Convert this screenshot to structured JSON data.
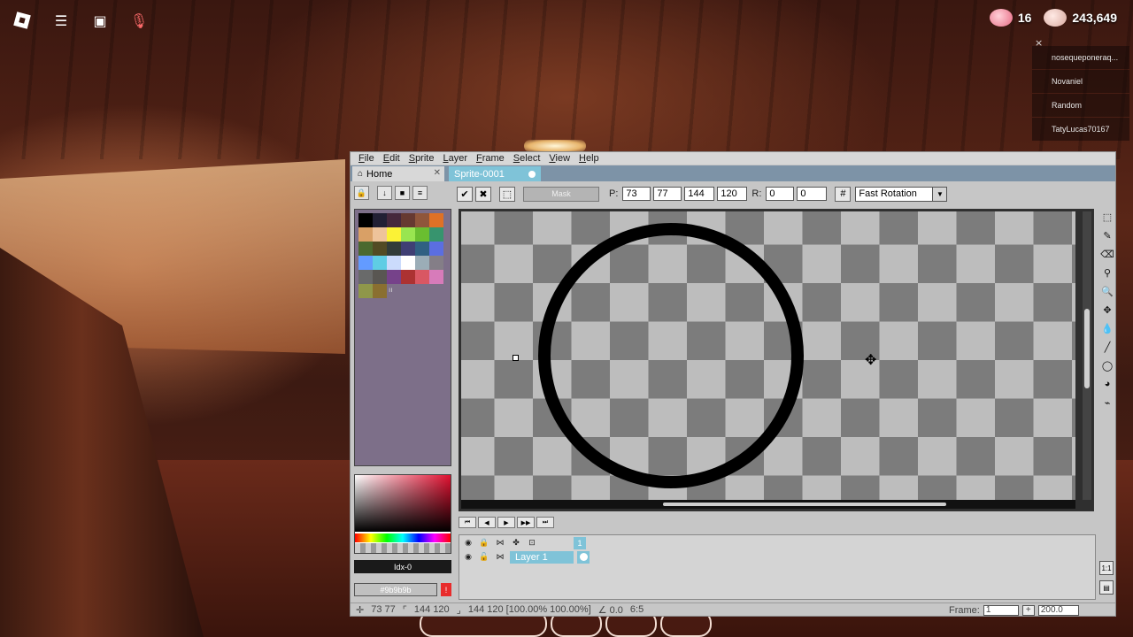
{
  "roblox": {
    "currency": {
      "hearts": "16",
      "coins": "243,649"
    },
    "players": [
      "nosequeponeraq...",
      "Novaniel",
      "Random",
      "TatyLucas70167"
    ],
    "close_icon": "×"
  },
  "aseprite": {
    "menu": [
      "File",
      "Edit",
      "Sprite",
      "Layer",
      "Frame",
      "Select",
      "View",
      "Help"
    ],
    "tabs": {
      "home": "Home",
      "sprite": "Sprite-0001"
    },
    "context": {
      "mask_label": "Mask",
      "p_label": "P:",
      "x": "73",
      "y": "77",
      "w": "144",
      "h": "120",
      "r_label": "R:",
      "r1": "0",
      "r2": "0",
      "rotation": "Fast Rotation"
    },
    "palette": [
      "#000000",
      "#222034",
      "#45283c",
      "#663931",
      "#8f563b",
      "#df7126",
      "#d9a066",
      "#eec39a",
      "#fbf236",
      "#99e550",
      "#6abe30",
      "#37946e",
      "#4b692f",
      "#524b24",
      "#323c39",
      "#3f3f74",
      "#306082",
      "#5b6ee1",
      "#639bff",
      "#5fcde4",
      "#cbdbfc",
      "#ffffff",
      "#9badb7",
      "#847e87",
      "#696a6a",
      "#595652",
      "#76428a",
      "#ac3232",
      "#d95763",
      "#d77bba",
      "#8f974a",
      "#8a6f30"
    ],
    "palette_label": "ıı",
    "idx": "Idx-0",
    "hex": "#9b9b9b",
    "layer": {
      "name": "Layer 1",
      "frame": "1"
    },
    "status": {
      "pos": "73 77",
      "size1": "144 120",
      "size2": "144 120 [100.00% 100.00%]",
      "angle": "∠ 0.0",
      "ratio": "6:5",
      "frame_label": "Frame:",
      "frame_value": "1",
      "zoom": "200.0"
    }
  }
}
